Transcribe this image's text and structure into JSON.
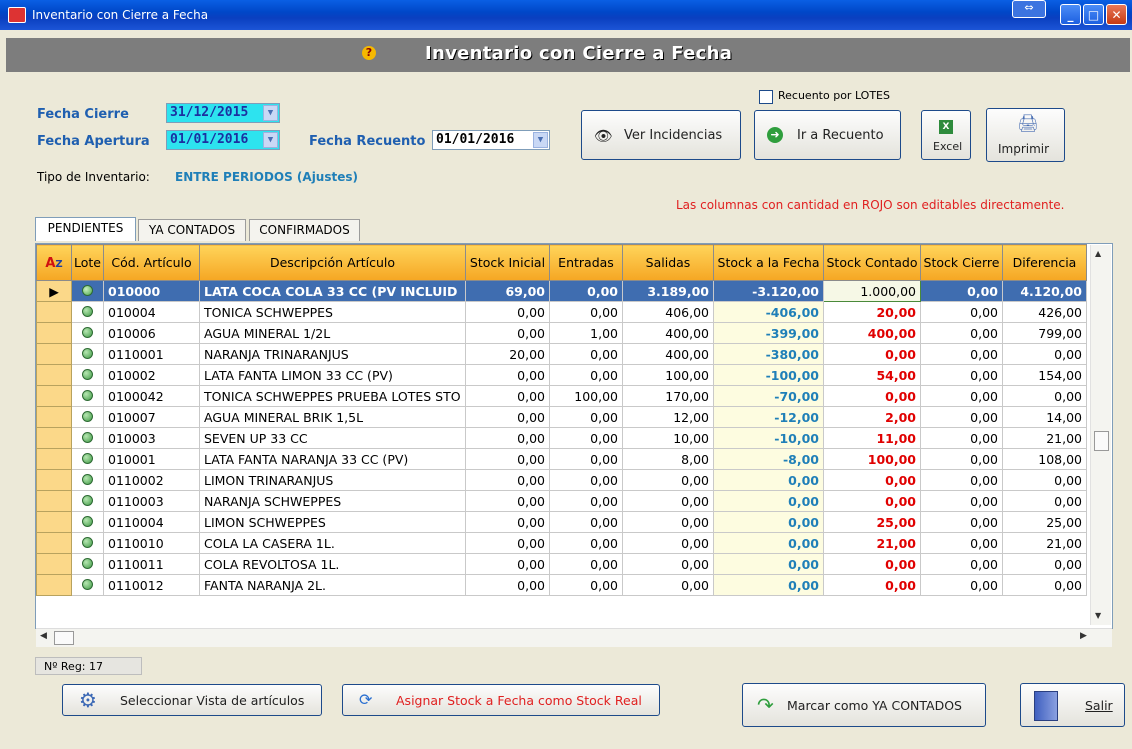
{
  "window": {
    "title": "Inventario con Cierre a Fecha"
  },
  "header": {
    "title": "Inventario con Cierre a Fecha"
  },
  "form": {
    "fecha_cierre_label": "Fecha Cierre",
    "fecha_cierre_value": "31/12/2015",
    "fecha_apertura_label": "Fecha Apertura",
    "fecha_apertura_value": "01/01/2016",
    "fecha_recuento_label": "Fecha Recuento",
    "fecha_recuento_value": "01/01/2016",
    "tipo_label": "Tipo de Inventario:",
    "tipo_value": "ENTRE PERIODOS (Ajustes)",
    "recuento_lotes_label": "Recuento por LOTES",
    "editable_note": "Las columnas con cantidad en ROJO son editables directamente."
  },
  "toolbar": {
    "ver_incidencias": "Ver Incidencias",
    "ir_recuento": "Ir a Recuento",
    "excel": "Excel",
    "imprimir": "Imprimir"
  },
  "tabs": [
    {
      "label": "PENDIENTES"
    },
    {
      "label": "YA CONTADOS"
    },
    {
      "label": "CONFIRMADOS"
    }
  ],
  "grid": {
    "columns": [
      "Lote",
      "Cód. Artículo",
      "Descripción Artículo",
      "Stock Inicial",
      "Entradas",
      "Salidas",
      "Stock a la Fecha",
      "Stock Contado",
      "Stock Cierre",
      "Diferencia"
    ],
    "rows": [
      [
        "010000",
        "LATA COCA COLA 33 CC    (PV INCLUID",
        "69,00",
        "0,00",
        "3.189,00",
        "-3.120,00",
        "1.000,00",
        "0,00",
        "4.120,00"
      ],
      [
        "010004",
        "TONICA SCHWEPPES",
        "0,00",
        "0,00",
        "406,00",
        "-406,00",
        "20,00",
        "0,00",
        "426,00"
      ],
      [
        "010006",
        "AGUA MINERAL 1/2L",
        "0,00",
        "1,00",
        "400,00",
        "-399,00",
        "400,00",
        "0,00",
        "799,00"
      ],
      [
        "0110001",
        "NARANJA TRINARANJUS",
        "20,00",
        "0,00",
        "400,00",
        "-380,00",
        "0,00",
        "0,00",
        "0,00"
      ],
      [
        "010002",
        "LATA FANTA LIMON 33 CC (PV)",
        "0,00",
        "0,00",
        "100,00",
        "-100,00",
        "54,00",
        "0,00",
        "154,00"
      ],
      [
        "0100042",
        "TONICA SCHWEPPES PRUEBA LOTES STO",
        "0,00",
        "100,00",
        "170,00",
        "-70,00",
        "0,00",
        "0,00",
        "0,00"
      ],
      [
        "010007",
        "AGUA MINERAL BRIK 1,5L",
        "0,00",
        "0,00",
        "12,00",
        "-12,00",
        "2,00",
        "0,00",
        "14,00"
      ],
      [
        "010003",
        "SEVEN UP 33 CC",
        "0,00",
        "0,00",
        "10,00",
        "-10,00",
        "11,00",
        "0,00",
        "21,00"
      ],
      [
        "010001",
        "LATA FANTA NARANJA 33 CC  (PV)",
        "0,00",
        "0,00",
        "8,00",
        "-8,00",
        "100,00",
        "0,00",
        "108,00"
      ],
      [
        "0110002",
        "LIMON TRINARANJUS",
        "0,00",
        "0,00",
        "0,00",
        "0,00",
        "0,00",
        "0,00",
        "0,00"
      ],
      [
        "0110003",
        "NARANJA SCHWEPPES",
        "0,00",
        "0,00",
        "0,00",
        "0,00",
        "0,00",
        "0,00",
        "0,00"
      ],
      [
        "0110004",
        "LIMON SCHWEPPES",
        "0,00",
        "0,00",
        "0,00",
        "0,00",
        "25,00",
        "0,00",
        "25,00"
      ],
      [
        "0110010",
        "COLA LA CASERA 1L.",
        "0,00",
        "0,00",
        "0,00",
        "0,00",
        "21,00",
        "0,00",
        "21,00"
      ],
      [
        "0110011",
        "COLA REVOLTOSA 1L.",
        "0,00",
        "0,00",
        "0,00",
        "0,00",
        "0,00",
        "0,00",
        "0,00"
      ],
      [
        "0110012",
        "FANTA NARANJA 2L.",
        "0,00",
        "0,00",
        "0,00",
        "0,00",
        "0,00",
        "0,00",
        "0,00"
      ]
    ]
  },
  "footer": {
    "registros": "Nº Reg:  17",
    "seleccionar_vista": "Seleccionar Vista de artículos",
    "asignar_stock": "Asignar Stock a Fecha como Stock Real",
    "marcar_contados": "Marcar como YA CONTADOS",
    "salir": "Salir"
  }
}
